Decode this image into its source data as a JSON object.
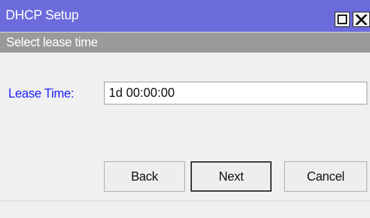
{
  "window": {
    "title": "DHCP Setup",
    "title_bar_color": "#6b6bdb"
  },
  "title_buttons": {
    "maximize_icon": "maximize-icon",
    "close_icon": "close-icon"
  },
  "section": {
    "header": "Select lease time",
    "header_color": "#9a9a9a"
  },
  "lease_time": {
    "label": "Lease Time:",
    "value": "1d 00:00:00",
    "label_color": "#2020ff"
  },
  "buttons": {
    "back": "Back",
    "next": "Next",
    "cancel": "Cancel"
  }
}
